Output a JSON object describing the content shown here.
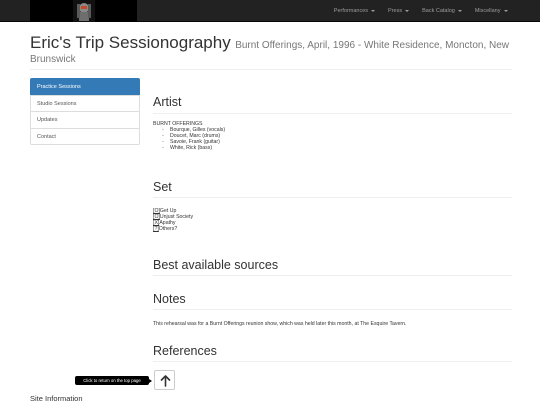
{
  "nav": {
    "items": [
      {
        "label": "Performances"
      },
      {
        "label": "Press"
      },
      {
        "label": "Back Catalog"
      },
      {
        "label": "Miscellany"
      }
    ]
  },
  "header": {
    "title": "Eric's Trip Sessionography",
    "subtitle_line1": "Burnt Offerings, April, 1996 - White Residence, Moncton, New",
    "subtitle_line2": "Brunswick"
  },
  "sidebar": {
    "items": [
      {
        "label": "Practice Sessions"
      },
      {
        "label": "Studio Sessions"
      },
      {
        "label": "Updates"
      },
      {
        "label": "Contact"
      }
    ]
  },
  "artist": {
    "heading": "Artist",
    "band": "BURNT OFFERINGS",
    "members": [
      "Bourque, Gilles (vocals)",
      "Doucet, Marc (drums)",
      "Savoie, Frank (guitar)",
      "White, Rick (bass)"
    ]
  },
  "set": {
    "heading": "Set",
    "songs": [
      {
        "marker": "[O]",
        "title": "Get Up"
      },
      {
        "marker": "[O]",
        "title": "Unjust Society"
      },
      {
        "marker": "[X]",
        "title": "Apathy"
      },
      {
        "marker": "[?]",
        "title": "Others?"
      }
    ]
  },
  "sources": {
    "heading": "Best available sources"
  },
  "notes": {
    "heading": "Notes",
    "text": "This rehearsal was for a Burnt Offerings reunion show, which was held later this month, at The Esquire Tavern."
  },
  "references": {
    "heading": "References"
  },
  "back_to_top": {
    "tooltip": "Click to return on the top page"
  },
  "footer": {
    "title": "Site Information"
  },
  "colors": {
    "navbar": "#222222",
    "active": "#337ab7",
    "nav_text": "#9d9d9d"
  },
  "icons": {
    "logo": "band-logo-icon",
    "top": "arrow-up-icon"
  }
}
